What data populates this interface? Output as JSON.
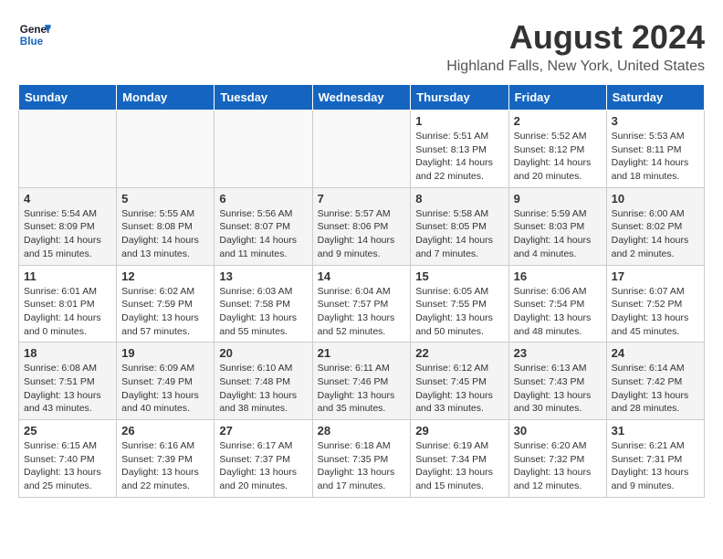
{
  "header": {
    "logo_general": "General",
    "logo_blue": "Blue",
    "month_title": "August 2024",
    "location": "Highland Falls, New York, United States"
  },
  "weekdays": [
    "Sunday",
    "Monday",
    "Tuesday",
    "Wednesday",
    "Thursday",
    "Friday",
    "Saturday"
  ],
  "weeks": [
    [
      {
        "day": "",
        "empty": true
      },
      {
        "day": "",
        "empty": true
      },
      {
        "day": "",
        "empty": true
      },
      {
        "day": "",
        "empty": true
      },
      {
        "day": "1",
        "sunrise": "5:51 AM",
        "sunset": "8:13 PM",
        "daylight": "14 hours and 22 minutes."
      },
      {
        "day": "2",
        "sunrise": "5:52 AM",
        "sunset": "8:12 PM",
        "daylight": "14 hours and 20 minutes."
      },
      {
        "day": "3",
        "sunrise": "5:53 AM",
        "sunset": "8:11 PM",
        "daylight": "14 hours and 18 minutes."
      }
    ],
    [
      {
        "day": "4",
        "sunrise": "5:54 AM",
        "sunset": "8:09 PM",
        "daylight": "14 hours and 15 minutes."
      },
      {
        "day": "5",
        "sunrise": "5:55 AM",
        "sunset": "8:08 PM",
        "daylight": "14 hours and 13 minutes."
      },
      {
        "day": "6",
        "sunrise": "5:56 AM",
        "sunset": "8:07 PM",
        "daylight": "14 hours and 11 minutes."
      },
      {
        "day": "7",
        "sunrise": "5:57 AM",
        "sunset": "8:06 PM",
        "daylight": "14 hours and 9 minutes."
      },
      {
        "day": "8",
        "sunrise": "5:58 AM",
        "sunset": "8:05 PM",
        "daylight": "14 hours and 7 minutes."
      },
      {
        "day": "9",
        "sunrise": "5:59 AM",
        "sunset": "8:03 PM",
        "daylight": "14 hours and 4 minutes."
      },
      {
        "day": "10",
        "sunrise": "6:00 AM",
        "sunset": "8:02 PM",
        "daylight": "14 hours and 2 minutes."
      }
    ],
    [
      {
        "day": "11",
        "sunrise": "6:01 AM",
        "sunset": "8:01 PM",
        "daylight": "14 hours and 0 minutes."
      },
      {
        "day": "12",
        "sunrise": "6:02 AM",
        "sunset": "7:59 PM",
        "daylight": "13 hours and 57 minutes."
      },
      {
        "day": "13",
        "sunrise": "6:03 AM",
        "sunset": "7:58 PM",
        "daylight": "13 hours and 55 minutes."
      },
      {
        "day": "14",
        "sunrise": "6:04 AM",
        "sunset": "7:57 PM",
        "daylight": "13 hours and 52 minutes."
      },
      {
        "day": "15",
        "sunrise": "6:05 AM",
        "sunset": "7:55 PM",
        "daylight": "13 hours and 50 minutes."
      },
      {
        "day": "16",
        "sunrise": "6:06 AM",
        "sunset": "7:54 PM",
        "daylight": "13 hours and 48 minutes."
      },
      {
        "day": "17",
        "sunrise": "6:07 AM",
        "sunset": "7:52 PM",
        "daylight": "13 hours and 45 minutes."
      }
    ],
    [
      {
        "day": "18",
        "sunrise": "6:08 AM",
        "sunset": "7:51 PM",
        "daylight": "13 hours and 43 minutes."
      },
      {
        "day": "19",
        "sunrise": "6:09 AM",
        "sunset": "7:49 PM",
        "daylight": "13 hours and 40 minutes."
      },
      {
        "day": "20",
        "sunrise": "6:10 AM",
        "sunset": "7:48 PM",
        "daylight": "13 hours and 38 minutes."
      },
      {
        "day": "21",
        "sunrise": "6:11 AM",
        "sunset": "7:46 PM",
        "daylight": "13 hours and 35 minutes."
      },
      {
        "day": "22",
        "sunrise": "6:12 AM",
        "sunset": "7:45 PM",
        "daylight": "13 hours and 33 minutes."
      },
      {
        "day": "23",
        "sunrise": "6:13 AM",
        "sunset": "7:43 PM",
        "daylight": "13 hours and 30 minutes."
      },
      {
        "day": "24",
        "sunrise": "6:14 AM",
        "sunset": "7:42 PM",
        "daylight": "13 hours and 28 minutes."
      }
    ],
    [
      {
        "day": "25",
        "sunrise": "6:15 AM",
        "sunset": "7:40 PM",
        "daylight": "13 hours and 25 minutes."
      },
      {
        "day": "26",
        "sunrise": "6:16 AM",
        "sunset": "7:39 PM",
        "daylight": "13 hours and 22 minutes."
      },
      {
        "day": "27",
        "sunrise": "6:17 AM",
        "sunset": "7:37 PM",
        "daylight": "13 hours and 20 minutes."
      },
      {
        "day": "28",
        "sunrise": "6:18 AM",
        "sunset": "7:35 PM",
        "daylight": "13 hours and 17 minutes."
      },
      {
        "day": "29",
        "sunrise": "6:19 AM",
        "sunset": "7:34 PM",
        "daylight": "13 hours and 15 minutes."
      },
      {
        "day": "30",
        "sunrise": "6:20 AM",
        "sunset": "7:32 PM",
        "daylight": "13 hours and 12 minutes."
      },
      {
        "day": "31",
        "sunrise": "6:21 AM",
        "sunset": "7:31 PM",
        "daylight": "13 hours and 9 minutes."
      }
    ]
  ]
}
